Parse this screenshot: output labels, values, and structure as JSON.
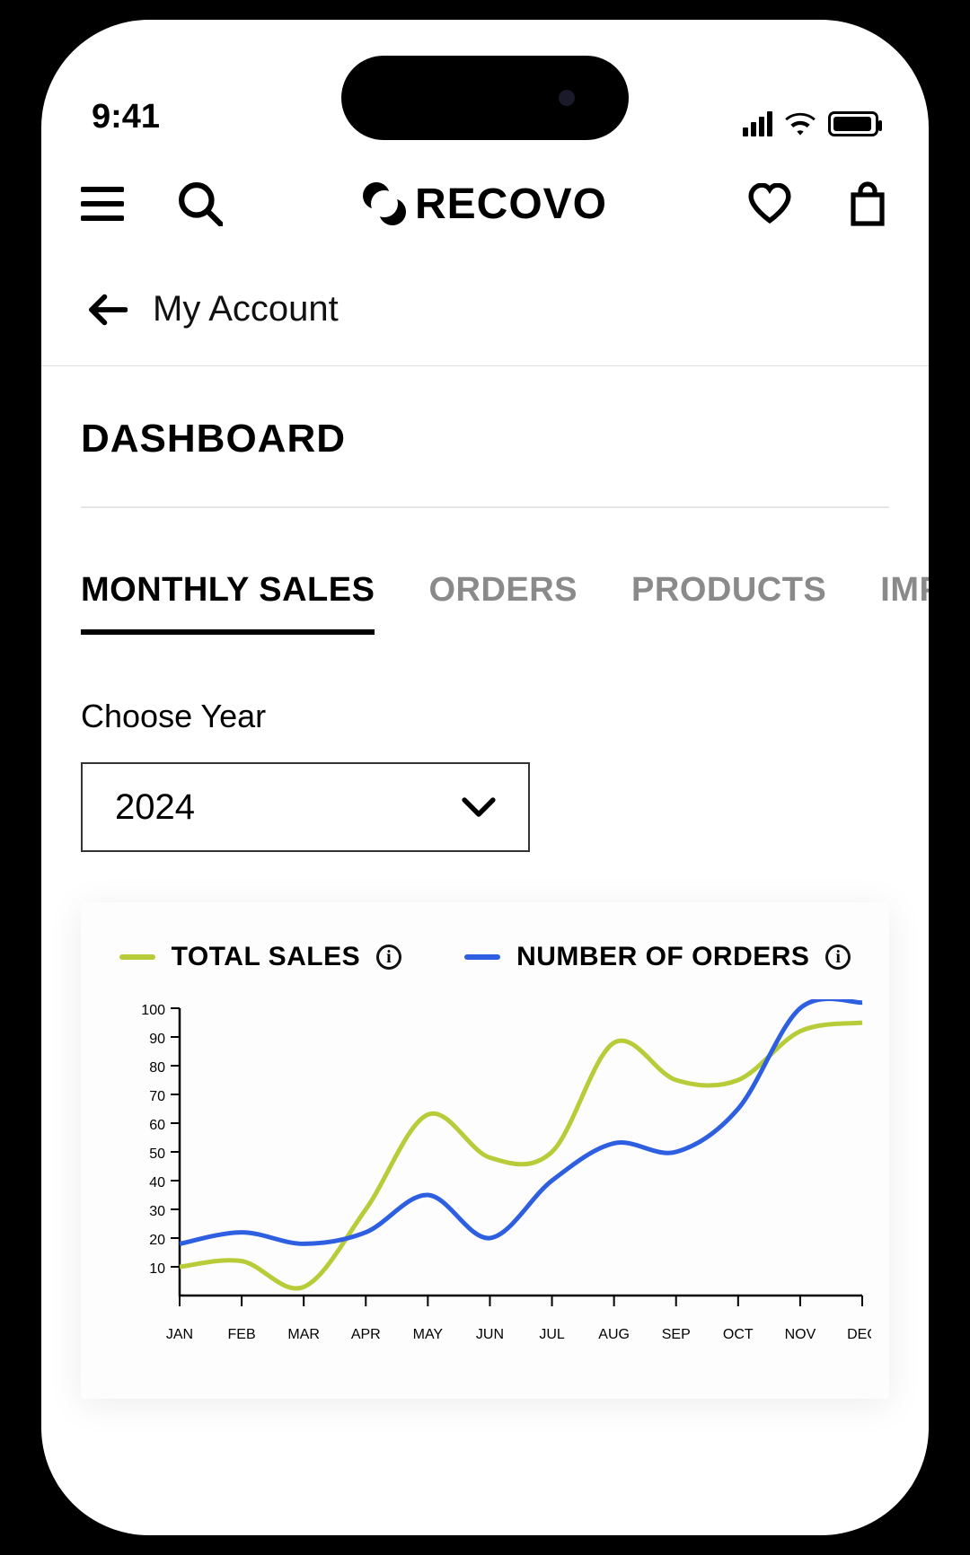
{
  "status": {
    "time": "9:41"
  },
  "brand": "RECOVO",
  "breadcrumb": {
    "label": "My Account"
  },
  "page": {
    "title": "DASHBOARD"
  },
  "tabs": [
    {
      "label": "MONTHLY SALES",
      "active": true
    },
    {
      "label": "ORDERS",
      "active": false
    },
    {
      "label": "PRODUCTS",
      "active": false
    },
    {
      "label": "IMPA",
      "active": false
    }
  ],
  "year_field": {
    "label": "Choose Year",
    "value": "2024"
  },
  "legend": {
    "series1": "TOTAL SALES",
    "series2": "NUMBER OF ORDERS"
  },
  "chart_data": {
    "type": "line",
    "ylabel": "",
    "xlabel": "",
    "ylim": [
      0,
      100
    ],
    "yticks": [
      10,
      20,
      30,
      40,
      50,
      60,
      70,
      80,
      90,
      100
    ],
    "categories": [
      "JAN",
      "FEB",
      "MAR",
      "APR",
      "MAY",
      "JUN",
      "JUL",
      "AUG",
      "SEP",
      "OCT",
      "NOV",
      "DEC"
    ],
    "series": [
      {
        "name": "TOTAL SALES",
        "color": "#b8cc3a",
        "values": [
          10,
          12,
          3,
          30,
          63,
          48,
          50,
          88,
          75,
          75,
          92,
          95
        ]
      },
      {
        "name": "NUMBER OF ORDERS",
        "color": "#2d5fe0",
        "values": [
          18,
          22,
          18,
          22,
          35,
          20,
          40,
          53,
          50,
          65,
          100,
          102
        ]
      }
    ]
  }
}
